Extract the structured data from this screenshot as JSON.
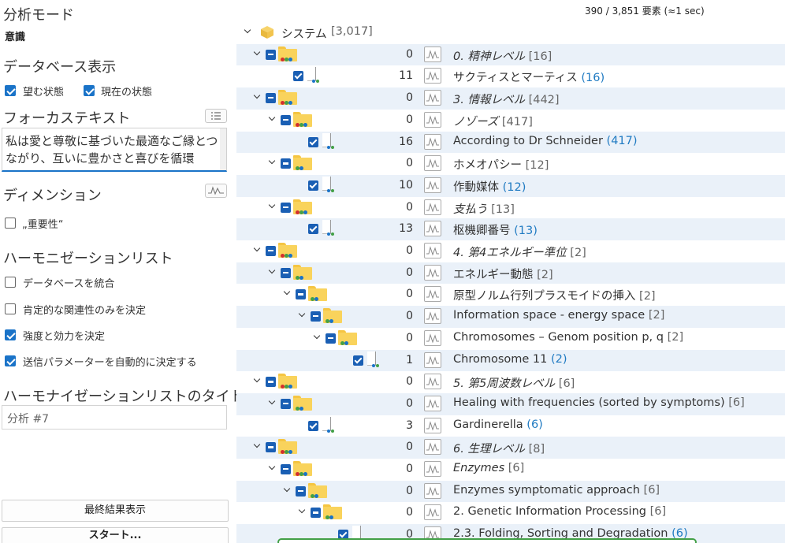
{
  "left_panel": {
    "analysis_mode_title": "分析モード",
    "analysis_mode_value": "意識",
    "database_display_title": "データベース表示",
    "desired_state_label": "望む状態",
    "current_state_label": "現在の状態",
    "focus_text_title": "フォーカステキスト",
    "focus_text_value": "私は愛と尊敬に基づいた最適なご縁とつながり、互いに豊かさと喜びを循環",
    "dimension_title": "ディメンション",
    "importance_label": "„重要性“",
    "harmonization_list_title": "ハーモニゼーションリスト",
    "merge_db_label": "データベースを統合",
    "positive_only_label": "肯定的な関連性のみを決定",
    "strength_label": "強度と効力を決定",
    "auto_params_label": "送信パラメーターを自動的に決定する",
    "list_title_heading": "ハーモナイゼーションリストのタイトル",
    "list_title_value": "分析 #7",
    "final_result_button": "最終結果表示",
    "start_button": "スタート..."
  },
  "status": "390 / 3,851 要素 (≈1 sec)",
  "tree": {
    "root_label": "システム",
    "root_count": "[3,017]",
    "rows": [
      {
        "count": "0",
        "label": "0. 精神レベル",
        "suffix": "[16]",
        "italic": true,
        "kind": "folder"
      },
      {
        "count": "11",
        "label": "サクティスとマーティス",
        "suffix": "(16)",
        "italic": false,
        "kind": "doc"
      },
      {
        "count": "0",
        "label": "3. 情報レベル",
        "suffix": "[442]",
        "italic": true,
        "kind": "folder"
      },
      {
        "count": "0",
        "label": "ノゾーズ",
        "suffix": "[417]",
        "italic": true,
        "kind": "folder"
      },
      {
        "count": "16",
        "label": "According to Dr Schneider",
        "suffix": "(417)",
        "italic": false,
        "kind": "doc"
      },
      {
        "count": "0",
        "label": "ホメオパシー",
        "suffix": "[12]",
        "italic": false,
        "kind": "folder"
      },
      {
        "count": "10",
        "label": "作動媒体",
        "suffix": "(12)",
        "italic": false,
        "kind": "doc"
      },
      {
        "count": "0",
        "label": "支払う",
        "suffix": "[13]",
        "italic": true,
        "kind": "folder"
      },
      {
        "count": "13",
        "label": "枢機卿番号",
        "suffix": "(13)",
        "italic": false,
        "kind": "doc"
      },
      {
        "count": "0",
        "label": "4. 第4エネルギー準位",
        "suffix": "[2]",
        "italic": true,
        "kind": "folder"
      },
      {
        "count": "0",
        "label": "エネルギー動態",
        "suffix": "[2]",
        "italic": false,
        "kind": "folder"
      },
      {
        "count": "0",
        "label": "原型ノルム行列プラスモイドの挿入",
        "suffix": "[2]",
        "italic": false,
        "kind": "folder"
      },
      {
        "count": "0",
        "label": "Information space - energy space",
        "suffix": "[2]",
        "italic": false,
        "kind": "folder"
      },
      {
        "count": "0",
        "label": "Chromosomes – Genom position p, q",
        "suffix": "[2]",
        "italic": false,
        "kind": "folder"
      },
      {
        "count": "1",
        "label": "Chromosome 11",
        "suffix": "(2)",
        "italic": false,
        "kind": "doc"
      },
      {
        "count": "0",
        "label": "5. 第5周波数レベル",
        "suffix": "[6]",
        "italic": true,
        "kind": "folder"
      },
      {
        "count": "0",
        "label": "Healing with frequencies (sorted by symptoms)",
        "suffix": "[6]",
        "italic": false,
        "kind": "folder"
      },
      {
        "count": "3",
        "label": "Gardinerella",
        "suffix": "(6)",
        "italic": false,
        "kind": "doc"
      },
      {
        "count": "0",
        "label": "6. 生理レベル",
        "suffix": "[8]",
        "italic": true,
        "kind": "folder"
      },
      {
        "count": "0",
        "label": "Enzymes",
        "suffix": "[6]",
        "italic": true,
        "kind": "folder"
      },
      {
        "count": "0",
        "label": "Enzymes symptomatic approach",
        "suffix": "[6]",
        "italic": false,
        "kind": "folder"
      },
      {
        "count": "0",
        "label": "2. Genetic Information Processing",
        "suffix": "[6]",
        "italic": false,
        "kind": "folder"
      },
      {
        "count": "0",
        "label": "2.3. Folding, Sorting and Degradation",
        "suffix": "(6)",
        "italic": false,
        "kind": "doc"
      }
    ]
  },
  "colors": {
    "accent": "#1a73c8",
    "count_blue": "#1f7ac2",
    "alt_row": "#eaf1f9",
    "folder": "#f9d35c"
  }
}
